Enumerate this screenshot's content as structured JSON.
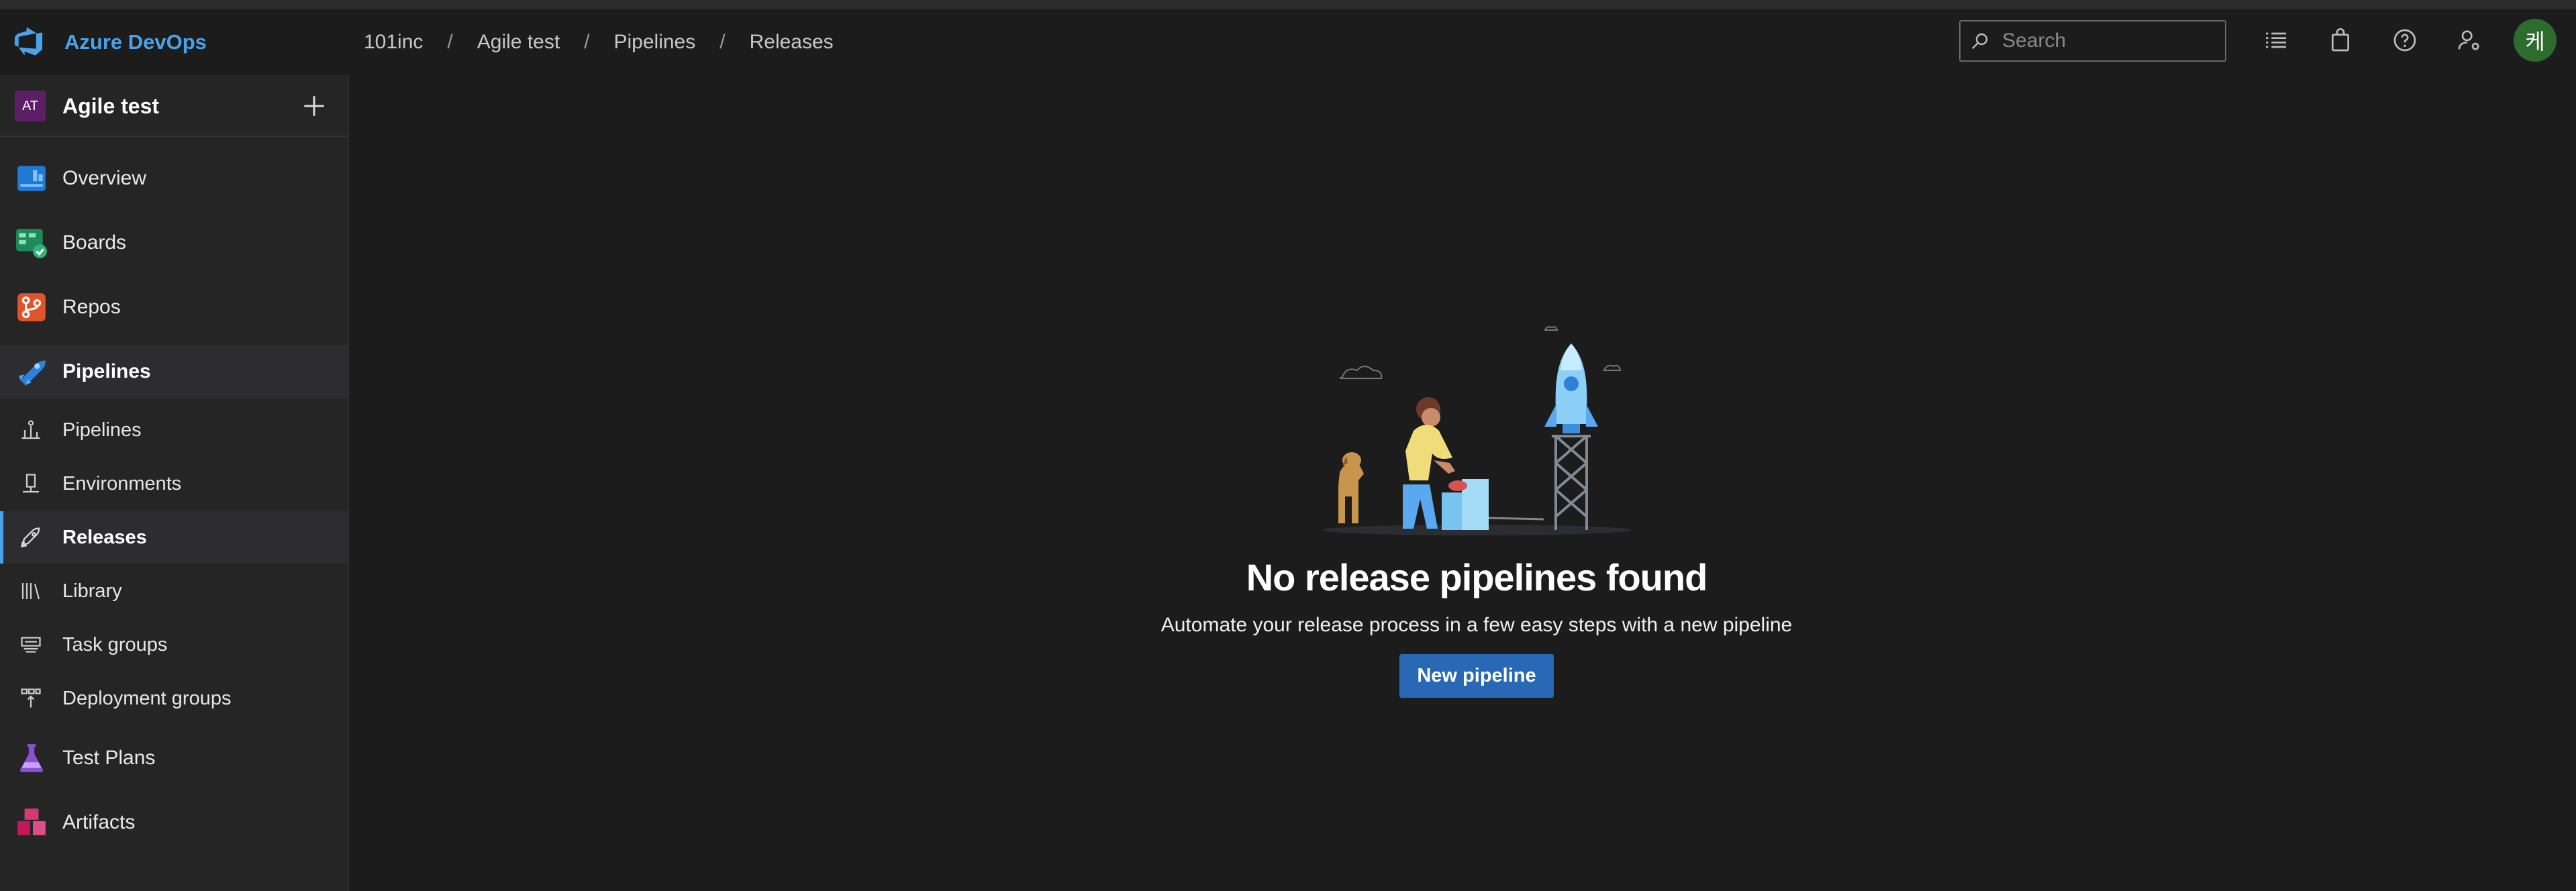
{
  "brand": {
    "name": "Azure DevOps"
  },
  "breadcrumb": [
    "101inc",
    "Agile test",
    "Pipelines",
    "Releases"
  ],
  "search": {
    "placeholder": "Search"
  },
  "header_icons": [
    "list-icon",
    "shopping-bag-icon",
    "help-icon",
    "user-settings-icon"
  ],
  "user": {
    "avatar_text": "케"
  },
  "project": {
    "badge": "AT",
    "name": "Agile test"
  },
  "nav": {
    "overview": "Overview",
    "boards": "Boards",
    "repos": "Repos",
    "pipelines": "Pipelines",
    "sub": [
      "Pipelines",
      "Environments",
      "Releases",
      "Library",
      "Task groups",
      "Deployment groups"
    ],
    "test_plans": "Test Plans",
    "artifacts": "Artifacts"
  },
  "empty_state": {
    "title": "No release pipelines found",
    "subtitle": "Automate your release process in a few easy steps with a new pipeline",
    "button": "New pipeline"
  },
  "colors": {
    "accent": "#4aa3ea",
    "button": "#2868b5",
    "background": "#1c1c1c",
    "sidebar": "#252526"
  }
}
